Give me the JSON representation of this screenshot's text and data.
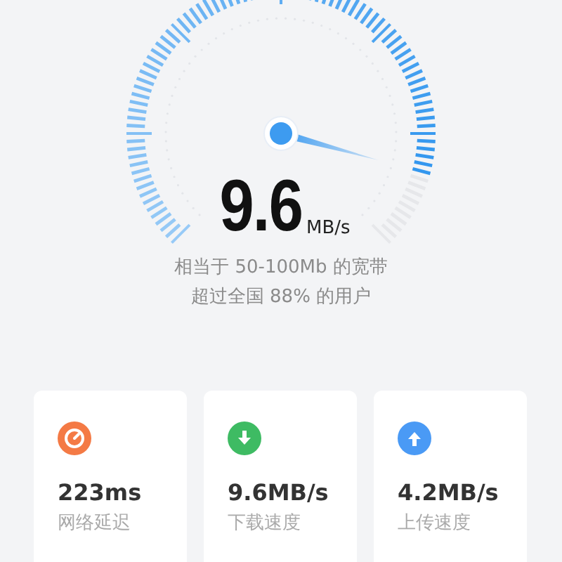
{
  "speed": {
    "value": "9.6",
    "unit": "MB/s"
  },
  "summary": [
    "相当于 50-100Mb 的宽带",
    "超过全国 88% 的用户"
  ],
  "stats": [
    {
      "kind": "latency",
      "color": "#f47a45",
      "value": "223ms",
      "label": "网络延迟"
    },
    {
      "kind": "download",
      "color": "#3ebb63",
      "value": "9.6MB/s",
      "label": "下载速度"
    },
    {
      "kind": "upload",
      "color": "#4a9af5",
      "value": "4.2MB/s",
      "label": "上传速度"
    }
  ]
}
